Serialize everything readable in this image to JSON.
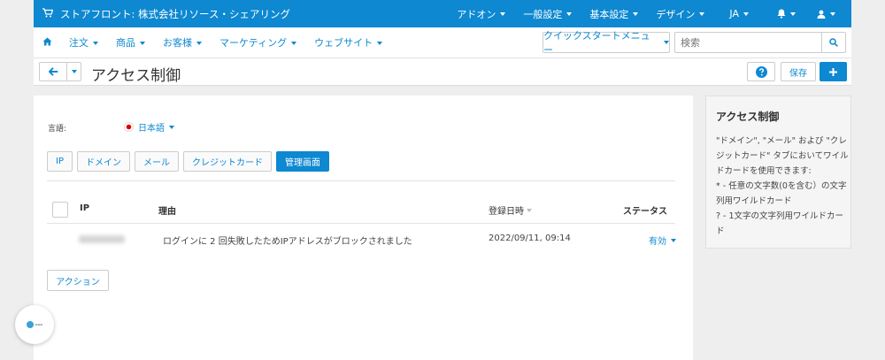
{
  "topbar": {
    "store_name": "ストアフロント: 株式会社リソース・シェアリング",
    "menus": [
      {
        "label": "アドオン"
      },
      {
        "label": "一般設定"
      },
      {
        "label": "基本設定"
      },
      {
        "label": "デザイン"
      },
      {
        "label": "JA"
      }
    ]
  },
  "navbar": {
    "items": [
      {
        "label": "注文"
      },
      {
        "label": "商品"
      },
      {
        "label": "お客様"
      },
      {
        "label": "マーケティング"
      },
      {
        "label": "ウェブサイト"
      }
    ],
    "quickstart_label": "クイックスタートメニュー",
    "search_placeholder": "検索"
  },
  "titlebar": {
    "title": "アクセス制御",
    "save_label": "保存"
  },
  "main": {
    "language_label": "言語:",
    "language_value": "日本語",
    "tabs": [
      {
        "label": "IP",
        "active": false
      },
      {
        "label": "ドメイン",
        "active": false
      },
      {
        "label": "メール",
        "active": false
      },
      {
        "label": "クレジットカード",
        "active": false
      },
      {
        "label": "管理画面",
        "active": true
      }
    ],
    "table": {
      "headers": {
        "ip": "IP",
        "reason": "理由",
        "date": "登録日時",
        "status": "ステータス"
      },
      "rows": [
        {
          "reason": "ログインに 2 回失敗したためIPアドレスがブロックされました",
          "date": "2022/09/11, 09:14",
          "status": "有効"
        }
      ]
    },
    "action_label": "アクション"
  },
  "sidebar": {
    "title": "アクセス制御",
    "line1": "\"ドメイン\", \"メール\" および \"クレジットカード\" タブにおいてワイルドカードを使用できます:",
    "line2": "* - 任意の文字数(0を含む）の文字列用ワイルドカード",
    "line3": "? - 1文字の文字列用ワイルドカード"
  },
  "colors": {
    "accent": "#0d88d1",
    "background": "#eeeeee"
  },
  "icons": [
    "cart-icon",
    "bell-icon",
    "user-icon",
    "home-icon",
    "search-icon",
    "arrow-left-icon",
    "question-icon",
    "plus-icon"
  ]
}
